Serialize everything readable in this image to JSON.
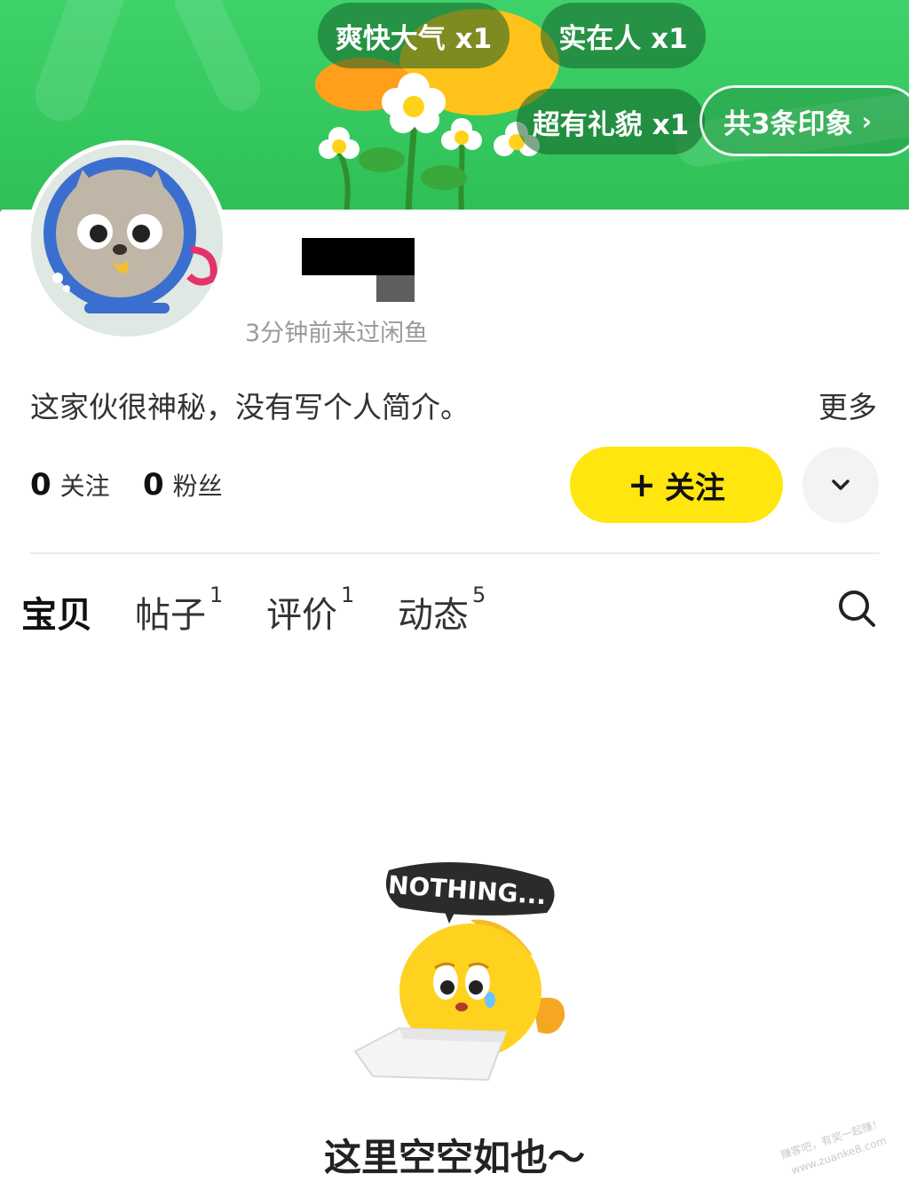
{
  "banner": {
    "tags": [
      {
        "label": "爽快大气 x1"
      },
      {
        "label": "实在人 x1"
      },
      {
        "label": "超有礼貌 x1"
      }
    ],
    "summary_label": "共3条印象",
    "summary_chevron": "›"
  },
  "profile": {
    "last_seen": "3分钟前来过闲鱼",
    "bio": "这家伙很神秘，没有写个人简介。",
    "more_label": "更多",
    "following_count": "0",
    "following_label": "关注",
    "followers_count": "0",
    "followers_label": "粉丝"
  },
  "actions": {
    "follow_plus": "+",
    "follow_label": "关注"
  },
  "tabs": [
    {
      "label": "宝贝",
      "count": ""
    },
    {
      "label": "帖子",
      "count": "1"
    },
    {
      "label": "评价",
      "count": "1"
    },
    {
      "label": "动态",
      "count": "5"
    }
  ],
  "empty": {
    "bubble_text": "NOTHING...",
    "message": "这里空空如也～"
  },
  "colors": {
    "banner_green": "#34c85e",
    "accent_yellow": "#ffe60f"
  }
}
